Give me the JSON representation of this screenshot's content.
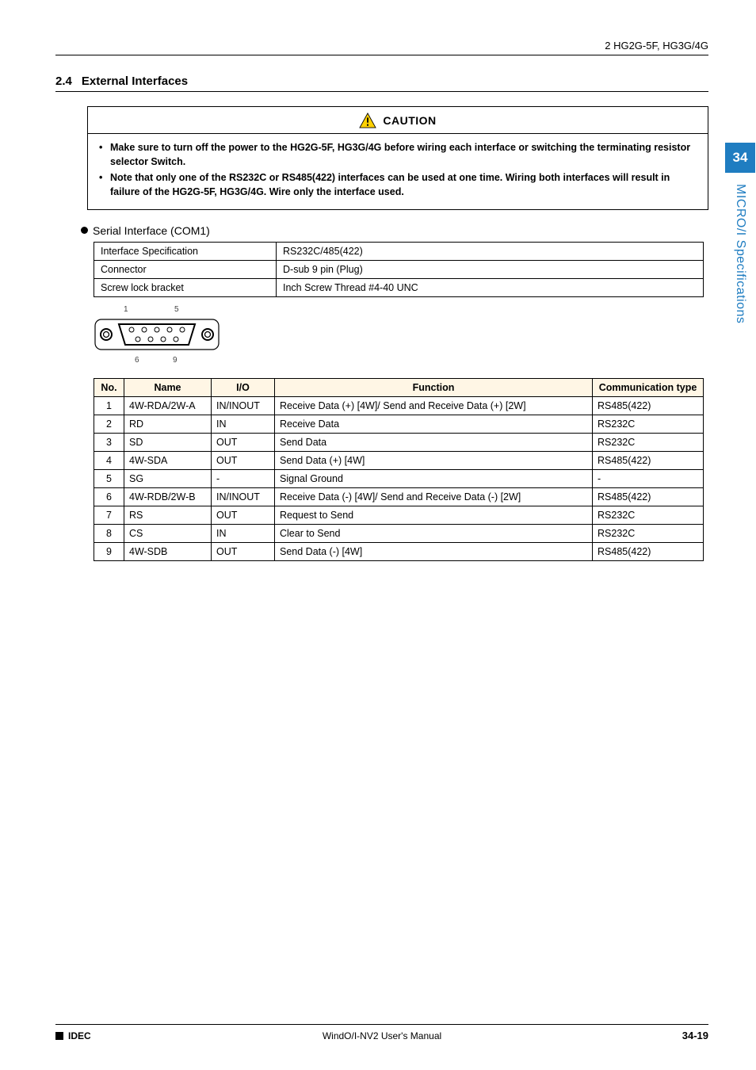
{
  "header": {
    "breadcrumb": "2 HG2G-5F, HG3G/4G"
  },
  "section": {
    "number": "2.4",
    "title": "External Interfaces"
  },
  "caution": {
    "label": "CAUTION",
    "items": [
      "Make sure to turn off the power to the HG2G-5F, HG3G/4G before wiring each interface or switching the terminating resistor selector Switch.",
      "Note that only one of the RS232C or RS485(422) interfaces can be used at one time. Wiring both interfaces will result in failure of the HG2G-5F, HG3G/4G. Wire only the interface used."
    ]
  },
  "subheading": "Serial Interface (COM1)",
  "spec_rows": [
    {
      "k": "Interface Specification",
      "v": "RS232C/485(422)"
    },
    {
      "k": "Connector",
      "v": "D-sub 9 pin (Plug)"
    },
    {
      "k": "Screw lock bracket",
      "v": "Inch Screw Thread #4-40 UNC"
    }
  ],
  "connector_pins": {
    "tl": "1",
    "tr": "5",
    "bl": "6",
    "br": "9"
  },
  "pins_header": {
    "no": "No.",
    "name": "Name",
    "io": "I/O",
    "func": "Function",
    "comm": "Communication type"
  },
  "pins": [
    {
      "no": "1",
      "name": "4W-RDA/2W-A",
      "io": "IN/INOUT",
      "func": "Receive Data (+) [4W]/ Send and Receive Data (+) [2W]",
      "comm": "RS485(422)"
    },
    {
      "no": "2",
      "name": "RD",
      "io": "IN",
      "func": "Receive Data",
      "comm": "RS232C"
    },
    {
      "no": "3",
      "name": "SD",
      "io": "OUT",
      "func": "Send Data",
      "comm": "RS232C"
    },
    {
      "no": "4",
      "name": "4W-SDA",
      "io": "OUT",
      "func": "Send Data (+) [4W]",
      "comm": "RS485(422)"
    },
    {
      "no": "5",
      "name": "SG",
      "io": "-",
      "func": "Signal Ground",
      "comm": "-"
    },
    {
      "no": "6",
      "name": "4W-RDB/2W-B",
      "io": "IN/INOUT",
      "func": "Receive Data (-) [4W]/ Send and Receive Data (-) [2W]",
      "comm": "RS485(422)"
    },
    {
      "no": "7",
      "name": "RS",
      "io": "OUT",
      "func": "Request to Send",
      "comm": "RS232C"
    },
    {
      "no": "8",
      "name": "CS",
      "io": "IN",
      "func": "Clear to Send",
      "comm": "RS232C"
    },
    {
      "no": "9",
      "name": "4W-SDB",
      "io": "OUT",
      "func": "Send Data (-) [4W]",
      "comm": "RS485(422)"
    }
  ],
  "side": {
    "chapter": "34",
    "label": "MICRO/I Specifications"
  },
  "footer": {
    "brand": "IDEC",
    "center": "WindO/I-NV2 User's Manual",
    "page": "34-19"
  }
}
